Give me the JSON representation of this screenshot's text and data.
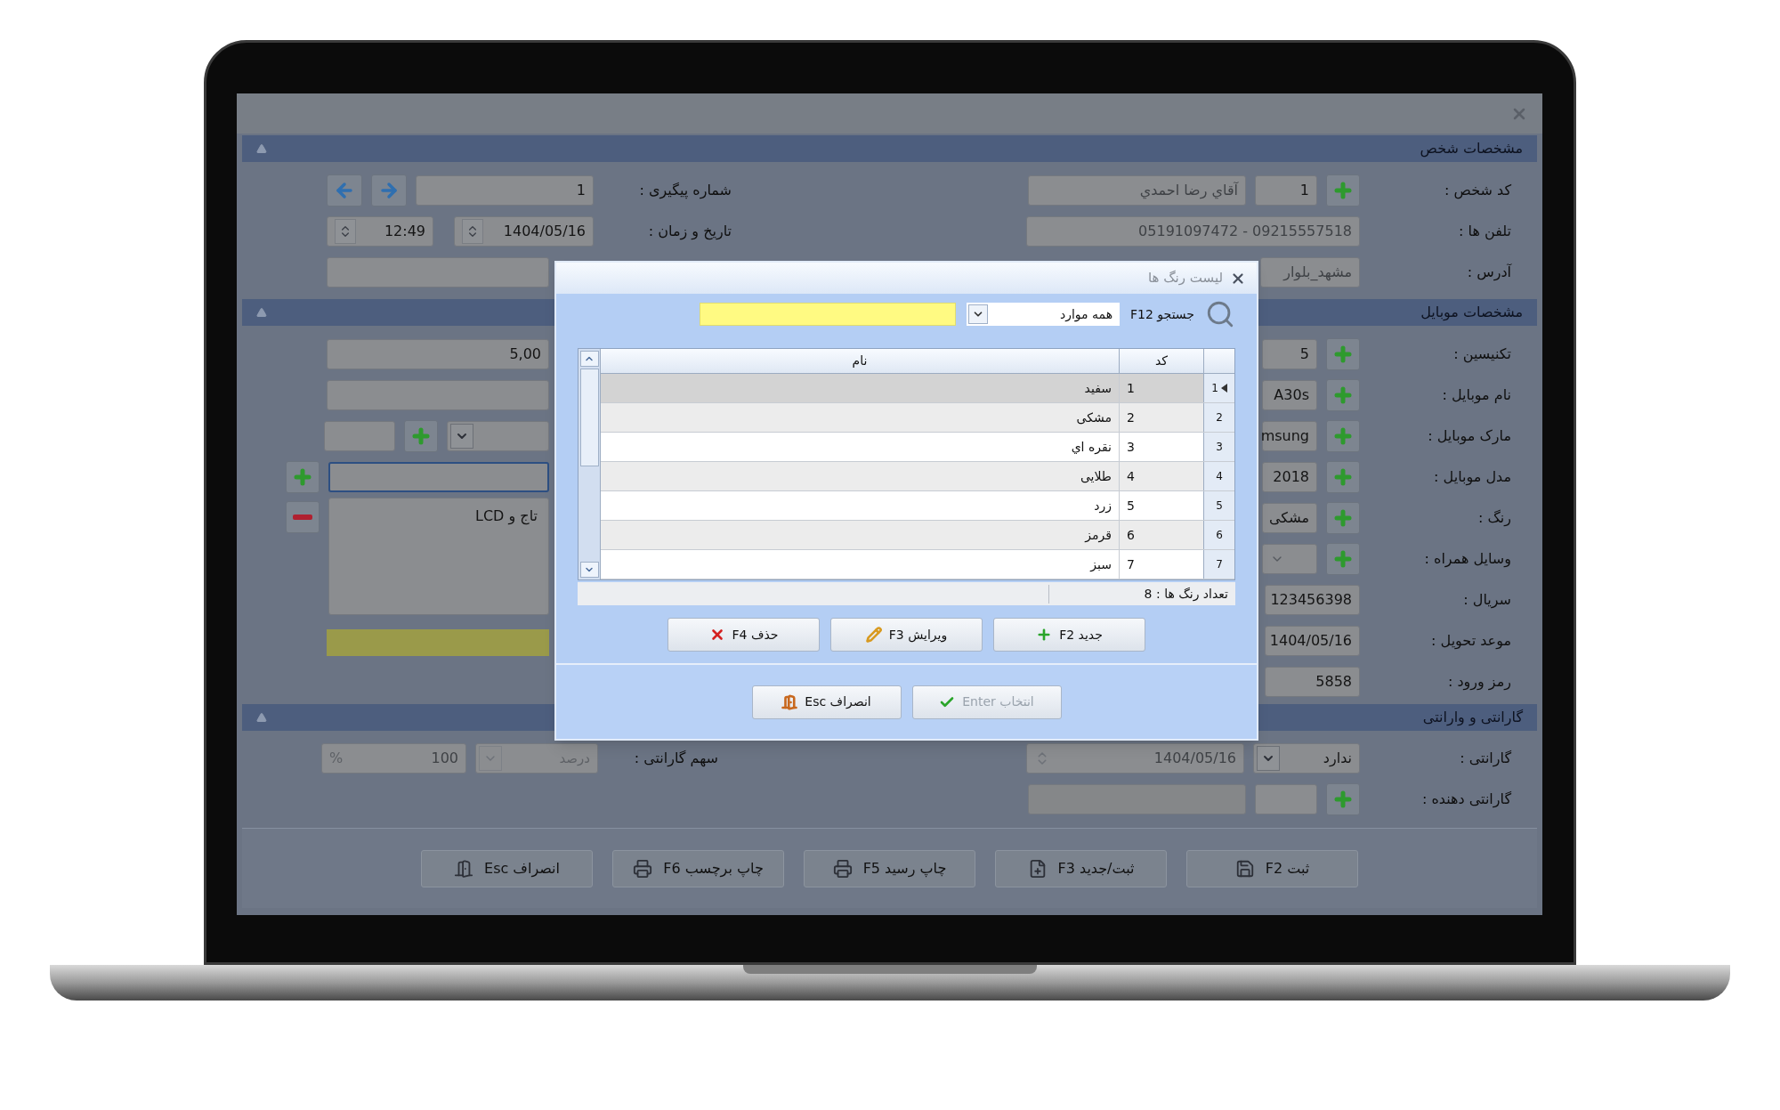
{
  "person": {
    "title": "مشخصات شخص",
    "code": {
      "label": "کد شخص :",
      "value": "1",
      "name": "آقاي رضا احمدي"
    },
    "phones": {
      "label": "تلفن ها :",
      "value": "05191097472 - 09215557518"
    },
    "address": {
      "label": "آدرس :",
      "value": "مشهد_بلوار"
    },
    "tracking": {
      "label": "شماره پیگیری :",
      "value": "1"
    },
    "datetime": {
      "label": "تاریخ و زمان :",
      "date": "1404/05/16",
      "time": "12:49"
    }
  },
  "mobile": {
    "title": "مشخصات موبایل",
    "fields": [
      {
        "kind": "add",
        "label": "تکنیسین :",
        "value": "5"
      },
      {
        "kind": "add",
        "label": "نام موبایل :",
        "value": "A30s"
      },
      {
        "kind": "add",
        "label": "مارک موبایل :",
        "value": "msung"
      },
      {
        "kind": "add",
        "label": "مدل موبایل :",
        "value": "2018"
      },
      {
        "kind": "add",
        "label": "رنگ :",
        "value": "مشکی"
      },
      {
        "kind": "combo",
        "label": "وسایل همراه :"
      },
      {
        "kind": "plain",
        "label": "سریال :",
        "value": "123456398"
      },
      {
        "kind": "plain",
        "label": "موعد تحویل :",
        "value": "1404/05/16"
      },
      {
        "kind": "plain",
        "label": "رمز ورود :",
        "value": "5858"
      }
    ],
    "amount": "5,00",
    "notes": "تاج و LCD"
  },
  "warranty": {
    "title": "گارانتی و وارانتی",
    "status": {
      "label": "گارانتی :",
      "value": "ندارد",
      "date": "1404/05/16"
    },
    "provider": {
      "label": "گارانتی دهنده :"
    },
    "share": {
      "label": "سهم گارانتی :",
      "unit": "درصد",
      "value": "100",
      "suffix": "%"
    }
  },
  "actions": [
    {
      "kind": "save",
      "label": "ثبت F2"
    },
    {
      "kind": "save_new",
      "label": "ثبت/جدید F3"
    },
    {
      "kind": "print",
      "label": "چاپ رسید F5"
    },
    {
      "kind": "print",
      "label": "چاپ برچسب F6"
    },
    {
      "kind": "cancel",
      "label": "انصراف Esc"
    }
  ],
  "dialog": {
    "title": "لیست رنگ ها",
    "search_label": "جستجو F12",
    "filter": "همه موارد",
    "columns": [
      "کد",
      "نام"
    ],
    "rows": [
      {
        "index": "1",
        "code": "1",
        "name": "سفید",
        "selected": true
      },
      {
        "index": "2",
        "code": "2",
        "name": "مشکی",
        "selected": false
      },
      {
        "index": "3",
        "code": "3",
        "name": "نقره اي",
        "selected": false
      },
      {
        "index": "4",
        "code": "4",
        "name": "طلایی",
        "selected": false
      },
      {
        "index": "5",
        "code": "5",
        "name": "زرد",
        "selected": false
      },
      {
        "index": "6",
        "code": "6",
        "name": "قرمز",
        "selected": false
      },
      {
        "index": "7",
        "code": "7",
        "name": "سبز",
        "selected": false
      }
    ],
    "footer": "تعداد رنگ ها : 8",
    "buttons": [
      {
        "kind": "add",
        "label": "جدید F2"
      },
      {
        "kind": "edit",
        "label": "ویرایش F3"
      },
      {
        "kind": "delete",
        "label": "حذف F4"
      }
    ],
    "confirm": [
      {
        "kind": "select",
        "label": "انتخاب Enter",
        "disabled": true
      },
      {
        "kind": "cancel",
        "label": "انصراف Esc",
        "disabled": false
      }
    ]
  }
}
